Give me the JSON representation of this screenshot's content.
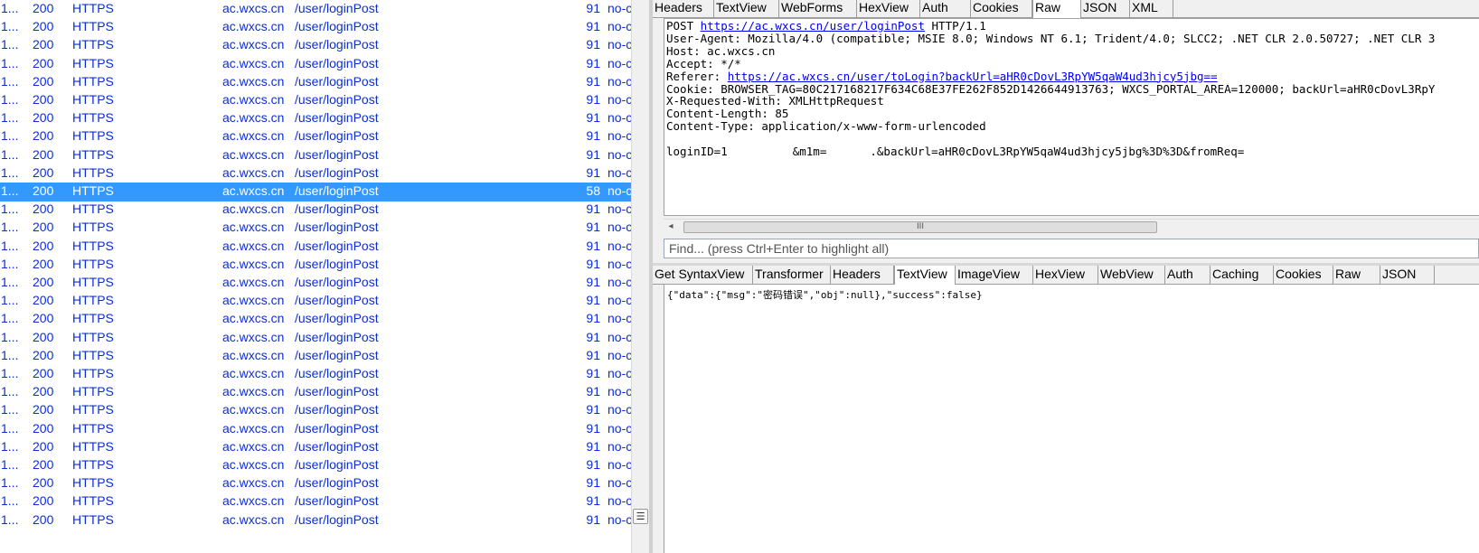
{
  "sessions": {
    "rows": [
      {
        "num": "1...",
        "result": "200",
        "protocol": "HTTPS",
        "host": "ac.wxcs.cn",
        "url": "/user/loginPost",
        "body": "91",
        "caching": "no-c"
      },
      {
        "num": "1...",
        "result": "200",
        "protocol": "HTTPS",
        "host": "ac.wxcs.cn",
        "url": "/user/loginPost",
        "body": "91",
        "caching": "no-c"
      },
      {
        "num": "1...",
        "result": "200",
        "protocol": "HTTPS",
        "host": "ac.wxcs.cn",
        "url": "/user/loginPost",
        "body": "91",
        "caching": "no-c"
      },
      {
        "num": "1...",
        "result": "200",
        "protocol": "HTTPS",
        "host": "ac.wxcs.cn",
        "url": "/user/loginPost",
        "body": "91",
        "caching": "no-c"
      },
      {
        "num": "1...",
        "result": "200",
        "protocol": "HTTPS",
        "host": "ac.wxcs.cn",
        "url": "/user/loginPost",
        "body": "91",
        "caching": "no-c"
      },
      {
        "num": "1...",
        "result": "200",
        "protocol": "HTTPS",
        "host": "ac.wxcs.cn",
        "url": "/user/loginPost",
        "body": "91",
        "caching": "no-c"
      },
      {
        "num": "1...",
        "result": "200",
        "protocol": "HTTPS",
        "host": "ac.wxcs.cn",
        "url": "/user/loginPost",
        "body": "91",
        "caching": "no-c"
      },
      {
        "num": "1...",
        "result": "200",
        "protocol": "HTTPS",
        "host": "ac.wxcs.cn",
        "url": "/user/loginPost",
        "body": "91",
        "caching": "no-c"
      },
      {
        "num": "1...",
        "result": "200",
        "protocol": "HTTPS",
        "host": "ac.wxcs.cn",
        "url": "/user/loginPost",
        "body": "91",
        "caching": "no-c"
      },
      {
        "num": "1...",
        "result": "200",
        "protocol": "HTTPS",
        "host": "ac.wxcs.cn",
        "url": "/user/loginPost",
        "body": "91",
        "caching": "no-c"
      },
      {
        "num": "1...",
        "result": "200",
        "protocol": "HTTPS",
        "host": "ac.wxcs.cn",
        "url": "/user/loginPost",
        "body": "58",
        "caching": "no-c",
        "selected": true
      },
      {
        "num": "1...",
        "result": "200",
        "protocol": "HTTPS",
        "host": "ac.wxcs.cn",
        "url": "/user/loginPost",
        "body": "91",
        "caching": "no-c"
      },
      {
        "num": "1...",
        "result": "200",
        "protocol": "HTTPS",
        "host": "ac.wxcs.cn",
        "url": "/user/loginPost",
        "body": "91",
        "caching": "no-c"
      },
      {
        "num": "1...",
        "result": "200",
        "protocol": "HTTPS",
        "host": "ac.wxcs.cn",
        "url": "/user/loginPost",
        "body": "91",
        "caching": "no-c"
      },
      {
        "num": "1...",
        "result": "200",
        "protocol": "HTTPS",
        "host": "ac.wxcs.cn",
        "url": "/user/loginPost",
        "body": "91",
        "caching": "no-c"
      },
      {
        "num": "1...",
        "result": "200",
        "protocol": "HTTPS",
        "host": "ac.wxcs.cn",
        "url": "/user/loginPost",
        "body": "91",
        "caching": "no-c"
      },
      {
        "num": "1...",
        "result": "200",
        "protocol": "HTTPS",
        "host": "ac.wxcs.cn",
        "url": "/user/loginPost",
        "body": "91",
        "caching": "no-c"
      },
      {
        "num": "1...",
        "result": "200",
        "protocol": "HTTPS",
        "host": "ac.wxcs.cn",
        "url": "/user/loginPost",
        "body": "91",
        "caching": "no-c"
      },
      {
        "num": "1...",
        "result": "200",
        "protocol": "HTTPS",
        "host": "ac.wxcs.cn",
        "url": "/user/loginPost",
        "body": "91",
        "caching": "no-c"
      },
      {
        "num": "1...",
        "result": "200",
        "protocol": "HTTPS",
        "host": "ac.wxcs.cn",
        "url": "/user/loginPost",
        "body": "91",
        "caching": "no-c"
      },
      {
        "num": "1...",
        "result": "200",
        "protocol": "HTTPS",
        "host": "ac.wxcs.cn",
        "url": "/user/loginPost",
        "body": "91",
        "caching": "no-c"
      },
      {
        "num": "1...",
        "result": "200",
        "protocol": "HTTPS",
        "host": "ac.wxcs.cn",
        "url": "/user/loginPost",
        "body": "91",
        "caching": "no-c"
      },
      {
        "num": "1...",
        "result": "200",
        "protocol": "HTTPS",
        "host": "ac.wxcs.cn",
        "url": "/user/loginPost",
        "body": "91",
        "caching": "no-c"
      },
      {
        "num": "1...",
        "result": "200",
        "protocol": "HTTPS",
        "host": "ac.wxcs.cn",
        "url": "/user/loginPost",
        "body": "91",
        "caching": "no-c"
      },
      {
        "num": "1...",
        "result": "200",
        "protocol": "HTTPS",
        "host": "ac.wxcs.cn",
        "url": "/user/loginPost",
        "body": "91",
        "caching": "no-c"
      },
      {
        "num": "1...",
        "result": "200",
        "protocol": "HTTPS",
        "host": "ac.wxcs.cn",
        "url": "/user/loginPost",
        "body": "91",
        "caching": "no-c"
      },
      {
        "num": "1...",
        "result": "200",
        "protocol": "HTTPS",
        "host": "ac.wxcs.cn",
        "url": "/user/loginPost",
        "body": "91",
        "caching": "no-c"
      },
      {
        "num": "1...",
        "result": "200",
        "protocol": "HTTPS",
        "host": "ac.wxcs.cn",
        "url": "/user/loginPost",
        "body": "91",
        "caching": "no-c"
      },
      {
        "num": "1...",
        "result": "200",
        "protocol": "HTTPS",
        "host": "ac.wxcs.cn",
        "url": "/user/loginPost",
        "body": "91",
        "caching": "no-c"
      }
    ],
    "colors": {
      "text": "#0d2ed6",
      "selected_bg": "#3399ff",
      "selected_text": "#ffffff"
    }
  },
  "request": {
    "tabs": [
      "Headers",
      "TextView",
      "WebForms",
      "HexView",
      "Auth",
      "Cookies",
      "Raw",
      "JSON",
      "XML"
    ],
    "active_tab": "Raw",
    "lines": {
      "request_line_method": "POST ",
      "request_line_url": "https://ac.wxcs.cn/user/loginPost",
      "request_line_version": " HTTP/1.1",
      "user_agent": "User-Agent: Mozilla/4.0 (compatible; MSIE 8.0; Windows NT 6.1; Trident/4.0; SLCC2; .NET CLR 2.0.50727; .NET CLR 3",
      "host": "Host: ac.wxcs.cn",
      "accept": "Accept: */*",
      "referer_label": "Referer: ",
      "referer_url": "https://ac.wxcs.cn/user/toLogin?backUrl=aHR0cDovL3RpYW5qaW4ud3hjcy5jbg==",
      "cookie": "Cookie: BROWSER_TAG=80C217168217F634C68E37FE262F852D1426644913763; WXCS_PORTAL_AREA=120000; backUrl=aHR0cDovL3RpY",
      "x_requested_with": "X-Requested-With: XMLHttpRequest",
      "content_length": "Content-Length: 85",
      "content_type": "Content-Type: application/x-www-form-urlencoded",
      "body_login": "loginID=1",
      "body_pwd": "&m1m=",
      "body_rest": ".&backUrl=aHR0cDovL3RpYW5qaW4ud3hjcy5jbg%3D%3D&fromReq="
    },
    "scroll_thumb_grip": "III",
    "find_placeholder": "Find... (press Ctrl+Enter to highlight all)"
  },
  "response": {
    "tabs": [
      "Get SyntaxView",
      "Transformer",
      "Headers",
      "TextView",
      "ImageView",
      "HexView",
      "WebView",
      "Auth",
      "Caching",
      "Cookies",
      "Raw",
      "JSON"
    ],
    "active_tab": "TextView",
    "body": "{\"data\":{\"msg\":\"密码错误\",\"obj\":null},\"success\":false}"
  },
  "ui": {
    "scroll_left_arrow": "◂",
    "grip_icon": "☰"
  }
}
